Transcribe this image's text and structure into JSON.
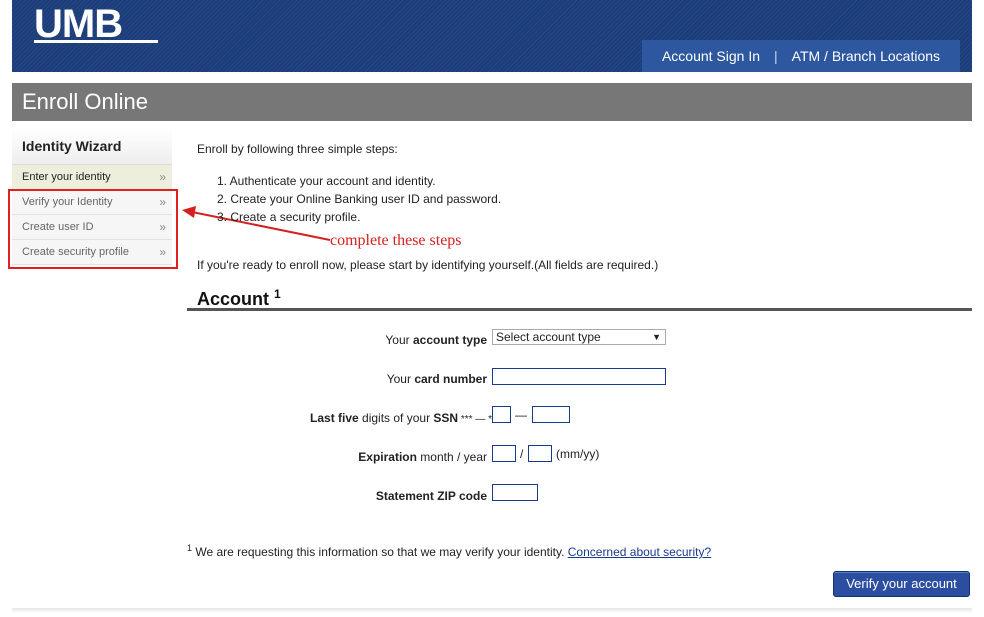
{
  "header": {
    "logo_text": "UMB",
    "nav": [
      "Account Sign In",
      "ATM / Branch Locations"
    ],
    "nav_separator": "|"
  },
  "page": {
    "title": "Enroll Online"
  },
  "sidebar": {
    "title": "Identity Wizard",
    "items": [
      {
        "label": "Enter your identity",
        "state": "active"
      },
      {
        "label": "Verify your Identity"
      },
      {
        "label": "Create user ID"
      },
      {
        "label": "Create security profile"
      }
    ],
    "chevron": "»"
  },
  "annotation": {
    "text": "complete these steps",
    "color": "#d42020"
  },
  "main": {
    "intro": "Enroll by following three simple steps:",
    "steps": [
      "1.  Authenticate your account and identity.",
      "2.  Create your Online Banking user ID and password.",
      "3.  Create a security profile."
    ],
    "ready": "If you're ready to enroll now, please start by identifying yourself.(All fields are required.)",
    "section_title": "Account",
    "section_sup": "1",
    "form": {
      "account_type": {
        "pre": "Your ",
        "bold": "account type",
        "placeholder": "Select account type"
      },
      "card_number": {
        "pre": "Your ",
        "bold": "card number"
      },
      "ssn": {
        "bold_pre": "Last five",
        "mid": " digits of your ",
        "bold": "SSN",
        "mask": " *** — *",
        "dash": "—"
      },
      "expiration": {
        "bold": "Expiration",
        "post": " month / year",
        "slash": "/",
        "format": "(mm/yy)"
      },
      "zip": {
        "bold": "Statement ZIP code"
      }
    },
    "footnote": {
      "sup": "1",
      "text": " We are requesting this information so that we may verify your identity. ",
      "link": "Concerned about security?"
    },
    "submit_label": "Verify your account"
  },
  "colors": {
    "header_blue": "#1b3d7a",
    "nav_blue": "#2d579e",
    "title_gray": "#777777",
    "button_blue": "#2b4ea0"
  }
}
